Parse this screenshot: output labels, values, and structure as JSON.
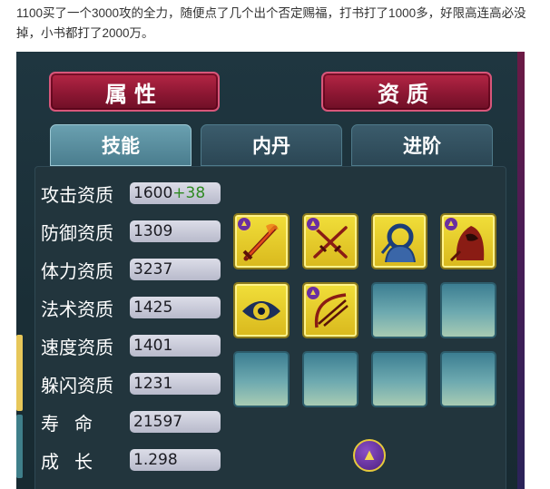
{
  "caption": "1100买了一个3000攻的全力，随便点了几个出个否定赐福，打书打了1000多，好限高连高必没掉，小书都打了2000万。",
  "top_buttons": {
    "attributes": "属性",
    "aptitude": "资质"
  },
  "tabs": [
    {
      "label": "技能",
      "active": true
    },
    {
      "label": "内丹",
      "active": false
    },
    {
      "label": "进阶",
      "active": false
    }
  ],
  "stats": [
    {
      "label": "攻击资质",
      "value": "1600",
      "bonus": "+38"
    },
    {
      "label": "防御资质",
      "value": "1309",
      "bonus": ""
    },
    {
      "label": "体力资质",
      "value": "3237",
      "bonus": ""
    },
    {
      "label": "法术资质",
      "value": "1425",
      "bonus": ""
    },
    {
      "label": "速度资质",
      "value": "1401",
      "bonus": ""
    },
    {
      "label": "躲闪资质",
      "value": "1231",
      "bonus": ""
    },
    {
      "label": "寿命",
      "value": "21597",
      "bonus": ""
    },
    {
      "label": "成长",
      "value": "1.298",
      "bonus": ""
    }
  ],
  "skill_slots": [
    {
      "icon": "flaming-sword-icon",
      "badge": true
    },
    {
      "icon": "crossed-swords-icon",
      "badge": true
    },
    {
      "icon": "blue-figure-icon",
      "badge": false
    },
    {
      "icon": "red-hood-icon",
      "badge": true
    },
    {
      "icon": "eye-icon",
      "badge": false
    },
    {
      "icon": "bow-arrows-icon",
      "badge": true
    },
    {
      "icon": "empty",
      "badge": false
    },
    {
      "icon": "empty",
      "badge": false
    },
    {
      "icon": "empty",
      "badge": false
    },
    {
      "icon": "empty",
      "badge": false
    },
    {
      "icon": "empty",
      "badge": false
    },
    {
      "icon": "empty",
      "badge": false
    }
  ],
  "colors": {
    "accent_red": "#8d1733",
    "bonus_green": "#2f8a22",
    "skill_gold": "#e3c62a",
    "badge_purple": "#6a2fa0"
  }
}
